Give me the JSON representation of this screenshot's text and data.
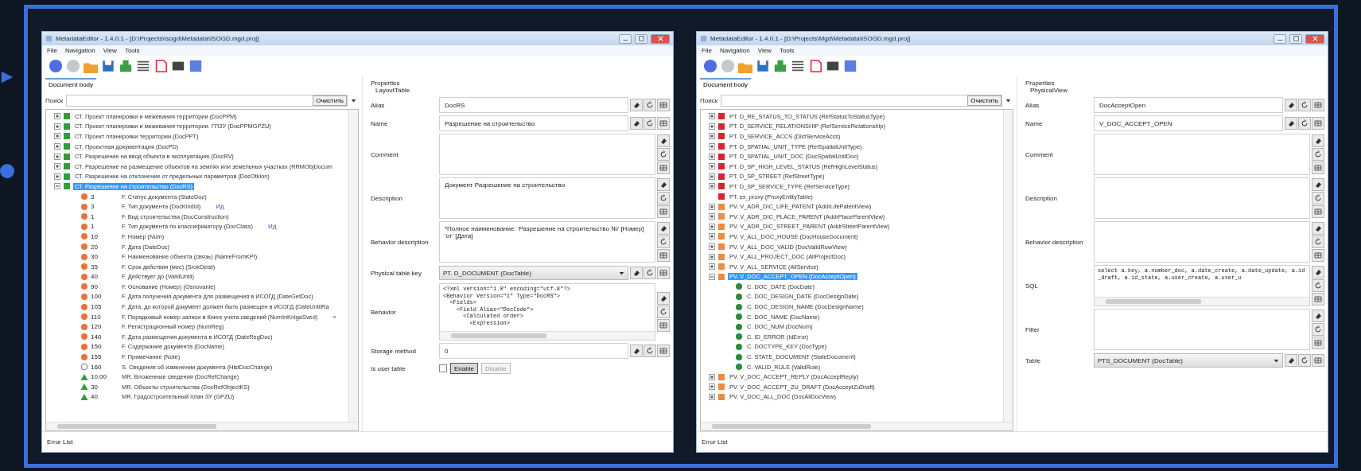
{
  "windows": [
    {
      "title": "MetadataEditor - 1.4.0.1 - [D:\\Projects\\Isogd\\Metadata\\ISOGD.mgd.proj]",
      "menu": [
        "File",
        "Navigation",
        "View",
        "Tools"
      ],
      "tab": "Document body",
      "search": {
        "label": "Поиск",
        "button": "Очистить"
      },
      "tree": [
        {
          "label": "СТ. Проект планировки и межевания территории (DocPPM)",
          "kind": "square",
          "color": "#2e9e3e",
          "expanded": false,
          "selected": false
        },
        {
          "label": "СТ. Проект планировки и межевания территории. ГПЗУ (DocPPMGPZU)",
          "kind": "square",
          "color": "#2e9e3e",
          "expanded": false,
          "selected": false
        },
        {
          "label": "СТ. Проект планировки территории (DocPPT)",
          "kind": "square",
          "color": "#2e9e3e",
          "expanded": false,
          "selected": false
        },
        {
          "label": "СТ. Проектная документация (DocPD)",
          "kind": "square",
          "color": "#2e9e3e",
          "expanded": false,
          "selected": false
        },
        {
          "label": "СТ. Разрешение на ввод объекта в эксплуатацию (DocRV)",
          "kind": "square",
          "color": "#2e9e3e",
          "expanded": false,
          "selected": false
        },
        {
          "label": "СТ. Разрешение на размещение объектов на землях или земельных участках (RRMObjDocum",
          "kind": "square",
          "color": "#2e9e3e",
          "expanded": false,
          "selected": false
        },
        {
          "label": "СТ. Разрешение на отклонение от предельных параметров (DocOtklon)",
          "kind": "square",
          "color": "#2e9e3e",
          "expanded": false,
          "selected": false
        },
        {
          "label": "СТ. Разрешение на строительство (DocRS)",
          "kind": "square",
          "color": "#2e9e3e",
          "expanded": true,
          "selected": true,
          "children": [
            {
              "number": "3",
              "label": "F. Статус документа (StateDoc)",
              "kind": "circle",
              "color": "#e8743b",
              "selected": false
            },
            {
              "number": "3",
              "label": "F. Тип документа (DocKindId)",
              "tag": "Ид",
              "kind": "circle",
              "color": "#e8743b",
              "selected": false
            },
            {
              "number": "1",
              "label": "F. Вид строительства (DocConstruction)",
              "kind": "circle",
              "color": "#e8743b",
              "selected": false
            },
            {
              "number": "1",
              "label": "F. Тип документа по классификатору (DocClass)",
              "tag": "Ид",
              "kind": "circle",
              "color": "#e8743b",
              "selected": false
            },
            {
              "number": "10",
              "label": "F. Номер (Num)",
              "kind": "circle",
              "color": "#e8743b",
              "selected": false
            },
            {
              "number": "20",
              "label": "F. Дата (DateDoc)",
              "kind": "circle",
              "color": "#e8743b",
              "selected": false
            },
            {
              "number": "30",
              "label": "F. Наименование объекта (связь) (NameFromKPI)",
              "kind": "circle",
              "color": "#e8743b",
              "selected": false
            },
            {
              "number": "35",
              "label": "F. Срок действия (мес) (SrokDeist)",
              "kind": "circle",
              "color": "#e8743b",
              "selected": false
            },
            {
              "number": "40",
              "label": "F. Действует до (ValidUntil)",
              "kind": "circle",
              "color": "#e8743b",
              "selected": false
            },
            {
              "number": "90",
              "label": "F. Основание (Номер) (Osnovanie)",
              "kind": "circle",
              "color": "#e8743b",
              "selected": false
            },
            {
              "number": "100",
              "label": "F. Дата получения документа для размещения в ИСОГД (DateGetDoc)",
              "kind": "circle",
              "color": "#e8743b",
              "selected": false
            },
            {
              "number": "105",
              "label": "F. Дата, до которой документ должен быть размещен в ИСОГД (DateUntilRa",
              "kind": "circle",
              "color": "#e8743b",
              "selected": false
            },
            {
              "number": "110",
              "label": "F. Порядковый номер записи в Книге учета сведений (NumInKnigaSved)",
              "tag": "«",
              "kind": "circle",
              "color": "#e8743b",
              "selected": false
            },
            {
              "number": "120",
              "label": "F. Регистрационный номер (NumReg)",
              "kind": "circle",
              "color": "#e8743b",
              "selected": false
            },
            {
              "number": "140",
              "label": "F. Дата размещения документа в ИСОГД (DateRegDoc)",
              "kind": "circle",
              "color": "#e8743b",
              "selected": false
            },
            {
              "number": "150",
              "label": "F. Содержание документа (DocName)",
              "kind": "circle",
              "color": "#e8743b",
              "selected": false
            },
            {
              "number": "155",
              "label": "F. Примечание (Note)",
              "kind": "circle",
              "color": "#e8743b",
              "selected": false
            },
            {
              "number": "160",
              "label": "S. Сведения об изменении документа (HistDocChange)",
              "kind": "ring",
              "selected": false
            },
            {
              "number": "10.00",
              "label": "MR. Вложенные сведения (DocRefChange)",
              "kind": "triangle",
              "color": "#2e9e3e",
              "selected": false
            },
            {
              "number": "30",
              "label": "MR. Объекты строительства (DocRefObjectKS)",
              "kind": "triangle",
              "color": "#2e9e3e",
              "selected": false
            },
            {
              "number": "40",
              "label": "MR. Градостроительный план ЗУ (GPZU)",
              "kind": "triangle",
              "color": "#2e9e3e",
              "selected": false
            }
          ]
        }
      ],
      "properties": {
        "title": "Properties",
        "group": "LayoutTable",
        "fields": [
          {
            "kind": "line",
            "label": "Alias",
            "value": "DocRS"
          },
          {
            "kind": "line",
            "label": "Name",
            "value": "Разрешение на строительство"
          },
          {
            "kind": "area",
            "label": "Comment"
          },
          {
            "kind": "area",
            "label": "Description",
            "value": "Документ Разрешение на строительство"
          },
          {
            "kind": "area",
            "label": "Behavior description",
            "value": "*Полное наименование: 'Разрешение на строительство №' [Номер] 'от' [Дата]"
          },
          {
            "kind": "combo",
            "label": "Physical table key",
            "value": "PT. D_DOCUMENT (DocTable)"
          },
          {
            "kind": "code",
            "label": "Behavior",
            "lines": [
              "<?xml version=\"1.0\" encoding=\"utf-8\"?>",
              "<Behavior Version=\"1\" Type=\"DocRS\">",
              "  <Fields>",
              "    <Field Alias=\"DocCode\">",
              "      <Calculated order>",
              "        <Expression>"
            ]
          },
          {
            "kind": "spin",
            "label": "Storage method",
            "value": "0"
          },
          {
            "kind": "check",
            "label": "Is user table",
            "checked": false,
            "buttons": [
              {
                "label": "Enable",
                "selected": true
              },
              {
                "label": "Disable",
                "selected": false
              }
            ]
          }
        ]
      },
      "status": "Error List"
    },
    {
      "title": "MetadataEditor - 1.4.0.1 - [D:\\Projects\\Mgd\\Metadata\\ISOGD.mgd.proj]",
      "menu": [
        "File",
        "Navigation",
        "View",
        "Tools"
      ],
      "tab": "Document body",
      "search": {
        "label": "Поиск",
        "button": "Очистить"
      },
      "tree": [
        {
          "label": "PT. D_RE_STATUS_TO_STATUS (RefStatusToStatusType)",
          "kind": "square",
          "color": "#d9232e",
          "expanded": false,
          "selected": false
        },
        {
          "label": "PT. D_SERVICE_RELATIONSHIP (RefServiceRelationship)",
          "kind": "square",
          "color": "#d9232e",
          "expanded": false,
          "selected": false
        },
        {
          "label": "PT. D_SERVICE_ACCS (DictServiceAccs)",
          "kind": "square",
          "color": "#d9232e",
          "expanded": false,
          "selected": false
        },
        {
          "label": "PT. D_SPATIAL_UNIT_TYPE (RefSpatialUnitType)",
          "kind": "square",
          "color": "#d9232e",
          "expanded": false,
          "selected": false
        },
        {
          "label": "PT. D_SPATIAL_UNIT_DOC (DocSpatialUnitDoc)",
          "kind": "square",
          "color": "#d9232e",
          "expanded": false,
          "selected": false
        },
        {
          "label": "PT. D_SP_HIGH_LEVEL_STATUS (RefHighLevelStatus)",
          "kind": "square",
          "color": "#d9232e",
          "expanded": false,
          "selected": false
        },
        {
          "label": "PT. D_SP_STREET (RefStreetType)",
          "kind": "square",
          "color": "#d9232e",
          "expanded": false,
          "selected": false
        },
        {
          "label": "PT. D_SP_SERVICE_TYPE (RefServiceType)",
          "kind": "square",
          "color": "#d9232e",
          "expanded": false,
          "selected": false
        },
        {
          "label": "PT. ex_proxy (ProxyEntityTable)",
          "kind": "square",
          "color": "#d9232e",
          "selected": false
        },
        {
          "label": "PV. V_ADR_DIC_LIFE_PATENT (AddrLifePatentView)",
          "kind": "square",
          "color": "#f08a3c",
          "expanded": false,
          "selected": false
        },
        {
          "label": "PV. V_ADR_DIC_PLACE_PARENT (AddrPlaceParentView)",
          "kind": "square",
          "color": "#f08a3c",
          "expanded": false,
          "selected": false
        },
        {
          "label": "PV. V_ADR_DIC_STREET_PARENT (AddrStreetParentView)",
          "kind": "square",
          "color": "#f08a3c",
          "expanded": false,
          "selected": false
        },
        {
          "label": "PV. V_ALL_DOC_HOUSE (DocHouseDocument)",
          "kind": "square",
          "color": "#f08a3c",
          "expanded": false,
          "selected": false
        },
        {
          "label": "PV. V_ALL_DOC_VALID (DocValidRowView)",
          "kind": "square",
          "color": "#f08a3c",
          "expanded": false,
          "selected": false
        },
        {
          "label": "PV. V_ALL_PROJECT_DOC (AllProjectDoc)",
          "kind": "square",
          "color": "#f08a3c",
          "expanded": false,
          "selected": false
        },
        {
          "label": "PV. V_ALL_SERVICE (AllService)",
          "kind": "square",
          "color": "#f08a3c",
          "expanded": false,
          "selected": false
        },
        {
          "label": "PV. V_DOC_ACCEPT_OPEN (DocAcceptOpen)",
          "kind": "square",
          "color": "#f08a3c",
          "expanded": true,
          "selected": true,
          "children": [
            {
              "label": "C. DOC_DATE (DocDate)",
              "kind": "circle",
              "color": "#2e8b3e",
              "selected": false
            },
            {
              "label": "C. DOC_DESIGN_DATE (DocDesignDate)",
              "kind": "circle",
              "color": "#2e8b3e",
              "selected": false
            },
            {
              "label": "C. DOC_DESIGN_NAME (DocDesignName)",
              "kind": "circle",
              "color": "#2e8b3e",
              "selected": false
            },
            {
              "label": "C. DOC_NAME (DocName)",
              "kind": "circle",
              "color": "#2e8b3e",
              "selected": false
            },
            {
              "label": "C. DOC_NUM (DocNum)",
              "kind": "circle",
              "color": "#2e8b3e",
              "selected": false
            },
            {
              "label": "C. ID_ERROR (IdError)",
              "kind": "circle",
              "color": "#2e8b3e",
              "selected": false
            },
            {
              "label": "C. DOCTYPE_KEY (DocType)",
              "kind": "circle",
              "color": "#2e8b3e",
              "selected": false
            },
            {
              "label": "C. STATE_DOCUMENT (StateDocument)",
              "kind": "circle",
              "color": "#2e8b3e",
              "selected": false
            },
            {
              "label": "C. VALID_RULE (ValidRule)",
              "kind": "circle",
              "color": "#2e8b3e",
              "selected": false
            }
          ]
        },
        {
          "label": "PV. V_DOC_ACCEPT_REPLY (DocAcceptReply)",
          "kind": "square",
          "color": "#f08a3c",
          "expanded": false,
          "selected": false
        },
        {
          "label": "PV. V_DOC_ACCEPT_ZU_DRAFT (DocAcceptZuDraft)",
          "kind": "square",
          "color": "#f08a3c",
          "expanded": false,
          "selected": false
        },
        {
          "label": "PV. V_DOC_ALL_DOC (DocAllDocView)",
          "kind": "square",
          "color": "#f08a3c",
          "expanded": false,
          "selected": false
        }
      ],
      "properties": {
        "title": "Properties",
        "group": "PhysicalView",
        "fields": [
          {
            "kind": "line",
            "label": "Alias",
            "value": "DocAcceptOpen"
          },
          {
            "kind": "line",
            "label": "Name",
            "value": "V_DOC_ACCEPT_OPEN"
          },
          {
            "kind": "area",
            "label": "Comment"
          },
          {
            "kind": "area",
            "label": "Description"
          },
          {
            "kind": "area",
            "label": "Behavior description"
          },
          {
            "kind": "code",
            "label": "SQL",
            "lines": [
              "select a.key, a.number_doc, a.date_create, a.date_update, a.id_draft, a.id_state, a.user_create, a.user_u"
            ]
          },
          {
            "kind": "area",
            "label": "Filter"
          },
          {
            "kind": "combo",
            "label": "Table",
            "value": "PTS_DOCUMENT (DocTable)"
          }
        ]
      },
      "status": "Error List"
    }
  ]
}
